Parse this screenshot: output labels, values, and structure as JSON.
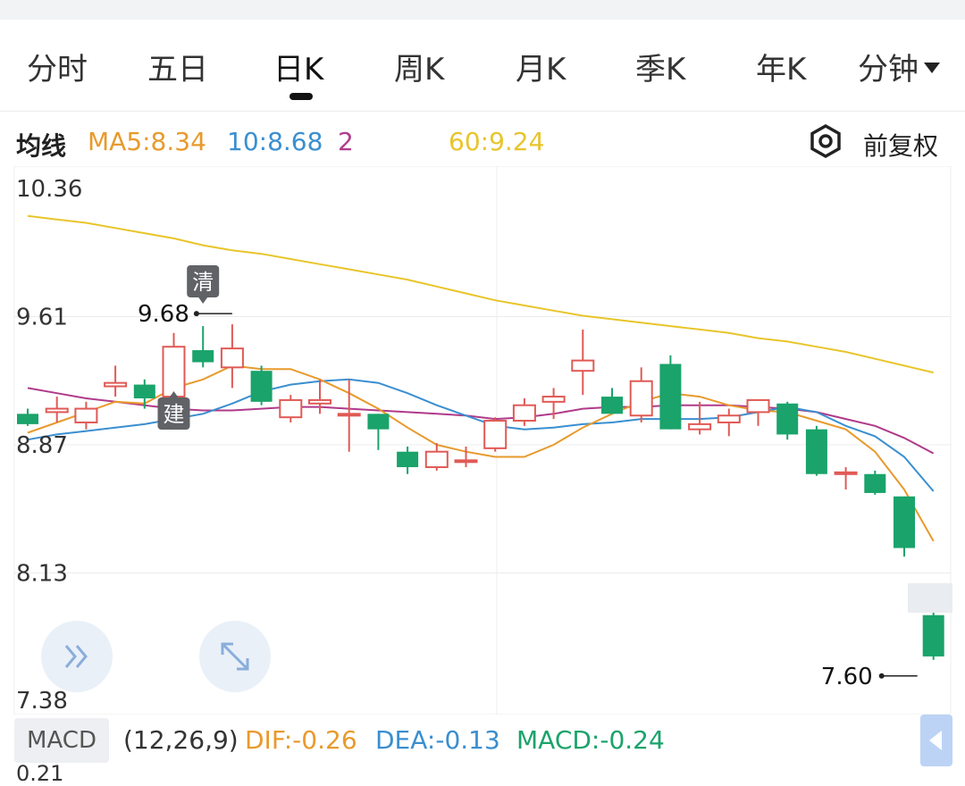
{
  "tabs": [
    "分时",
    "五日",
    "日K",
    "周K",
    "月K",
    "季K",
    "年K",
    "分钟"
  ],
  "active_tab": 2,
  "ma_bar": {
    "label": "均线",
    "ma5": "MA5:8.34",
    "ma10": "10:8.68",
    "ma20": "2",
    "ma60": "60:9.24",
    "adjust": "前复权",
    "colors": {
      "ma5": "#e89a2c",
      "ma10": "#3a8fd0",
      "ma20": "#b03a8a",
      "ma60": "#e8c52a"
    }
  },
  "macd_bar": {
    "button": "MACD",
    "params": "(12,26,9)",
    "dif": "DIF:-0.26",
    "dea": "DEA:-0.13",
    "macd": "MACD:-0.24",
    "colors": {
      "dif": "#e89a2c",
      "dea": "#3a8fd0",
      "macd": "#1aa36b"
    }
  },
  "bottom_axis_label": "0.21",
  "chart_data": {
    "type": "candlestick",
    "y_ticks": [
      "10.36",
      "9.61",
      "8.87",
      "8.13",
      "7.38"
    ],
    "ylim": [
      7.38,
      10.36
    ],
    "colors": {
      "up": "#e05a55",
      "down": "#1aa36b"
    },
    "annotations": {
      "max_label": "9.68",
      "min_label": "7.60",
      "badge_top": "清",
      "badge_bottom": "建"
    },
    "candles": [
      {
        "o": 9.05,
        "h": 9.08,
        "l": 8.98,
        "c": 8.99
      },
      {
        "o": 9.06,
        "h": 9.15,
        "l": 9.0,
        "c": 9.08
      },
      {
        "o": 9.0,
        "h": 9.12,
        "l": 8.96,
        "c": 9.08
      },
      {
        "o": 9.21,
        "h": 9.33,
        "l": 9.15,
        "c": 9.23
      },
      {
        "o": 9.22,
        "h": 9.25,
        "l": 9.08,
        "c": 9.14
      },
      {
        "o": 9.15,
        "h": 9.52,
        "l": 9.12,
        "c": 9.44
      },
      {
        "o": 9.42,
        "h": 9.56,
        "l": 9.32,
        "c": 9.35
      },
      {
        "o": 9.32,
        "h": 9.57,
        "l": 9.2,
        "c": 9.43
      },
      {
        "o": 9.3,
        "h": 9.33,
        "l": 9.1,
        "c": 9.12
      },
      {
        "o": 9.03,
        "h": 9.16,
        "l": 9.0,
        "c": 9.13
      },
      {
        "o": 9.11,
        "h": 9.25,
        "l": 9.05,
        "c": 9.13
      },
      {
        "o": 9.05,
        "h": 9.25,
        "l": 8.83,
        "c": 9.05
      },
      {
        "o": 9.05,
        "h": 9.05,
        "l": 8.84,
        "c": 8.96
      },
      {
        "o": 8.83,
        "h": 8.86,
        "l": 8.7,
        "c": 8.74
      },
      {
        "o": 8.74,
        "h": 8.88,
        "l": 8.72,
        "c": 8.83
      },
      {
        "o": 8.78,
        "h": 8.86,
        "l": 8.74,
        "c": 8.78
      },
      {
        "o": 8.85,
        "h": 9.03,
        "l": 8.83,
        "c": 9.01
      },
      {
        "o": 9.01,
        "h": 9.14,
        "l": 8.98,
        "c": 9.1
      },
      {
        "o": 9.12,
        "h": 9.2,
        "l": 9.02,
        "c": 9.15
      },
      {
        "o": 9.3,
        "h": 9.54,
        "l": 9.16,
        "c": 9.36
      },
      {
        "o": 9.15,
        "h": 9.2,
        "l": 9.05,
        "c": 9.05
      },
      {
        "o": 9.04,
        "h": 9.32,
        "l": 9.0,
        "c": 9.24
      },
      {
        "o": 9.34,
        "h": 9.39,
        "l": 8.96,
        "c": 8.96
      },
      {
        "o": 8.96,
        "h": 9.12,
        "l": 8.93,
        "c": 8.99
      },
      {
        "o": 9.0,
        "h": 9.08,
        "l": 8.92,
        "c": 9.04
      },
      {
        "o": 9.06,
        "h": 9.13,
        "l": 8.98,
        "c": 9.13
      },
      {
        "o": 9.11,
        "h": 9.12,
        "l": 8.9,
        "c": 8.93
      },
      {
        "o": 8.96,
        "h": 8.98,
        "l": 8.69,
        "c": 8.7
      },
      {
        "o": 8.71,
        "h": 8.74,
        "l": 8.61,
        "c": 8.71
      },
      {
        "o": 8.7,
        "h": 8.72,
        "l": 8.58,
        "c": 8.59
      },
      {
        "o": 8.57,
        "h": 8.57,
        "l": 8.22,
        "c": 8.27
      },
      {
        "o": 7.88,
        "h": 7.92,
        "l": 7.62,
        "c": 7.64
      }
    ],
    "ma_series": [
      {
        "key": "ma60",
        "values": [
          10.2,
          10.18,
          10.16,
          10.13,
          10.1,
          10.07,
          10.03,
          10.0,
          9.98,
          9.95,
          9.92,
          9.89,
          9.86,
          9.83,
          9.79,
          9.75,
          9.71,
          9.68,
          9.65,
          9.62,
          9.6,
          9.58,
          9.56,
          9.54,
          9.52,
          9.49,
          9.47,
          9.44,
          9.41,
          9.37,
          9.33,
          9.29
        ]
      },
      {
        "key": "ma20",
        "values": [
          9.2,
          9.17,
          9.14,
          9.12,
          9.1,
          9.08,
          9.07,
          9.07,
          9.08,
          9.09,
          9.09,
          9.08,
          9.07,
          9.06,
          9.05,
          9.04,
          9.02,
          9.03,
          9.05,
          9.08,
          9.09,
          9.09,
          9.1,
          9.1,
          9.1,
          9.09,
          9.08,
          9.06,
          9.02,
          8.98,
          8.91,
          8.82
        ]
      },
      {
        "key": "ma10",
        "values": [
          8.9,
          8.93,
          8.95,
          8.97,
          8.99,
          9.02,
          9.05,
          9.11,
          9.18,
          9.22,
          9.24,
          9.25,
          9.23,
          9.17,
          9.1,
          9.04,
          8.98,
          8.96,
          8.97,
          8.99,
          9.0,
          9.02,
          9.02,
          9.02,
          9.03,
          9.06,
          9.09,
          9.06,
          8.98,
          8.92,
          8.8,
          8.6
        ]
      },
      {
        "key": "ma5",
        "values": [
          8.94,
          9.0,
          9.06,
          9.12,
          9.11,
          9.2,
          9.25,
          9.33,
          9.31,
          9.31,
          9.25,
          9.17,
          9.08,
          8.97,
          8.87,
          8.83,
          8.8,
          8.8,
          8.87,
          8.97,
          9.05,
          9.12,
          9.17,
          9.15,
          9.1,
          9.07,
          9.06,
          9.01,
          8.96,
          8.83,
          8.61,
          8.31
        ]
      }
    ]
  }
}
